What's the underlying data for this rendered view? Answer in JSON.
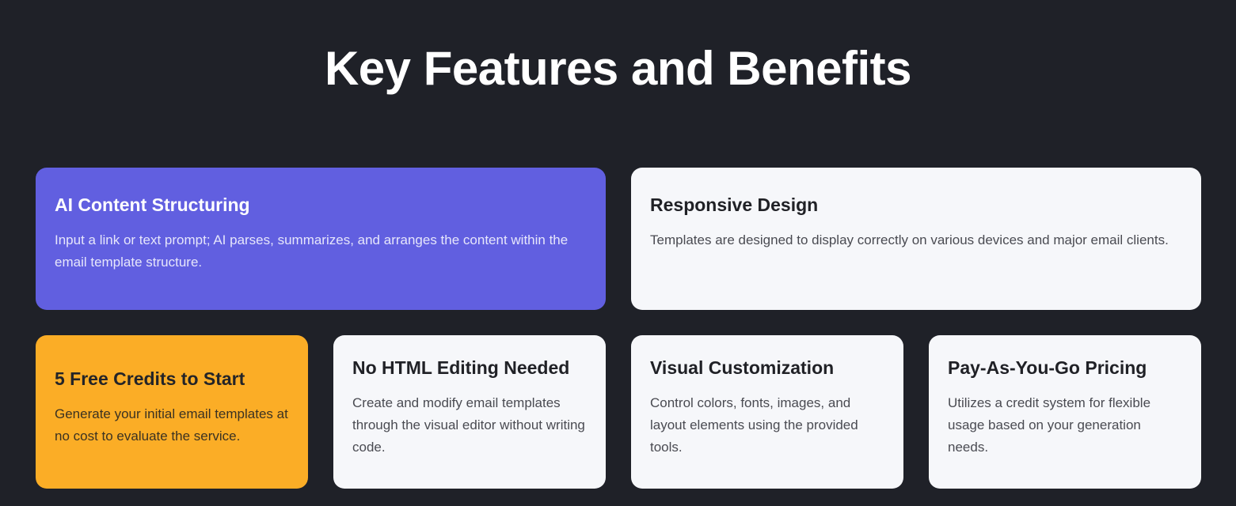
{
  "header": {
    "title": "Key Features and Benefits"
  },
  "features": {
    "ai": {
      "title": "AI Content Structuring",
      "description": "Input a link or text prompt; AI parses, summarizes, and arranges the content within the email template structure."
    },
    "responsive": {
      "title": "Responsive Design",
      "description": "Templates are designed to display correctly on various devices and major email clients."
    },
    "free_credits": {
      "title": "5 Free Credits to Start",
      "description": "Generate your initial email templates at no cost to evaluate the service."
    },
    "no_html": {
      "title": "No HTML Editing Needed",
      "description": "Create and modify email templates through the visual editor without writing code."
    },
    "visual": {
      "title": "Visual Customization",
      "description": "Control colors, fonts, images, and layout elements using the provided tools."
    },
    "payg": {
      "title": "Pay-As-You-Go Pricing",
      "description": "Utilizes a credit system for flexible usage based on your generation needs."
    }
  },
  "colors": {
    "background": "#1f2128",
    "accent_purple": "#615fe0",
    "accent_orange": "#fbad26",
    "card_light": "#f6f7fa"
  }
}
